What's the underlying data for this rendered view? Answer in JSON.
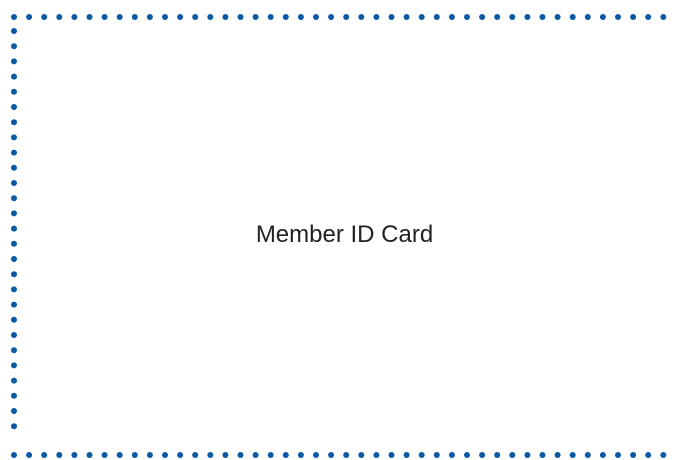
{
  "card": {
    "title": "Member ID Card"
  },
  "colors": {
    "border_dots": "#0b5aa6",
    "background": "#ffffff",
    "text": "#222222"
  }
}
